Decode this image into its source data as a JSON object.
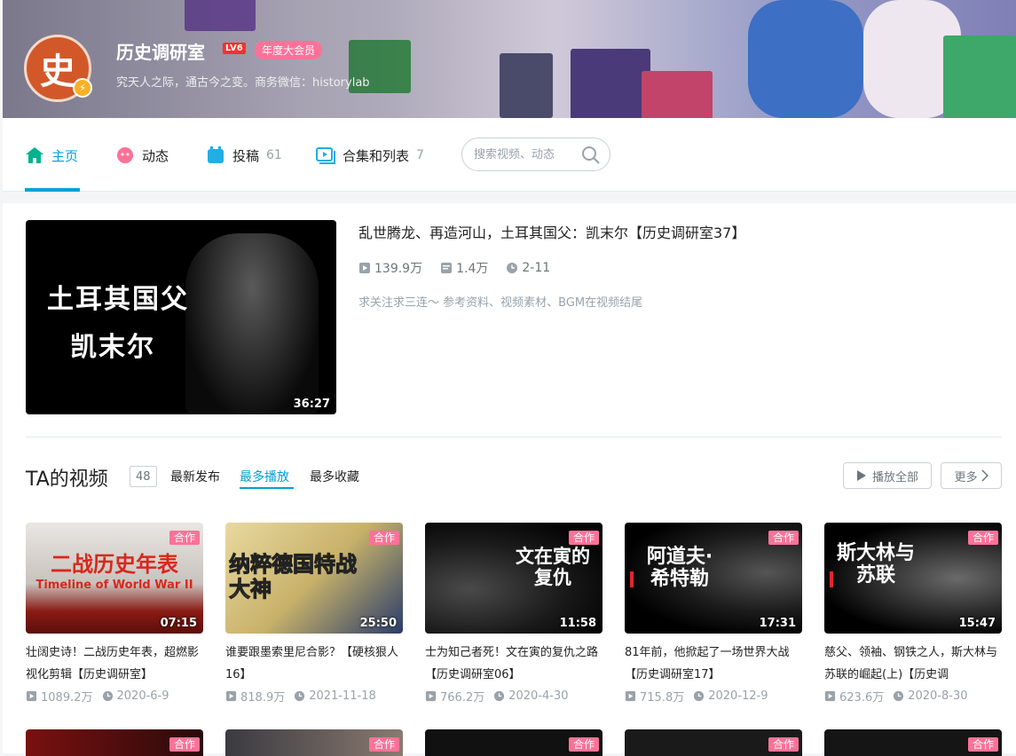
{
  "header": {
    "avatar_glyph": "史",
    "username": "历史调研室",
    "level": "LV6",
    "vip_label": "年度大会员",
    "sign": "究天人之际，通古今之变。商务微信：historylab"
  },
  "nav": {
    "items": [
      {
        "label": "主页",
        "count": "",
        "icon": "home-icon"
      },
      {
        "label": "动态",
        "count": "",
        "icon": "dynamic-icon"
      },
      {
        "label": "投稿",
        "count": "61",
        "icon": "upload-icon"
      },
      {
        "label": "合集和列表",
        "count": "7",
        "icon": "collection-icon"
      }
    ],
    "search_placeholder": "搜索视频、动态"
  },
  "featured": {
    "thumb_line1": "土耳其国父",
    "thumb_line2": "凯末尔",
    "duration": "36:27",
    "title": "乱世腾龙、再造河山，土耳其国父：凯末尔【历史调研室37】",
    "plays": "139.9万",
    "danmaku": "1.4万",
    "date": "2-11",
    "desc": "求关注求三连～ 参考资料、视频素材、BGM在视频结尾"
  },
  "videos_section": {
    "title": "TA的视频",
    "count": "48",
    "tabs": [
      "最新发布",
      "最多播放",
      "最多收藏"
    ],
    "play_all": "播放全部",
    "more": "更多"
  },
  "videos": [
    {
      "thumb_text": "二战历史年表",
      "thumb_sub": "Timeline of World War II",
      "tag": "合作",
      "duration": "07:15",
      "title": "壮阔史诗！二战历史年表，超燃影视化剪辑【历史调研室】",
      "plays": "1089.2万",
      "date": "2020-6-9"
    },
    {
      "thumb_text": "纳粹德国特战大神",
      "thumb_sub": "",
      "tag": "合作",
      "duration": "25:50",
      "title": "谁要跟墨索里尼合影？【硬核狠人16】",
      "plays": "818.9万",
      "date": "2021-11-18"
    },
    {
      "thumb_text": "文在寅的复仇",
      "thumb_sub": "",
      "tag": "合作",
      "duration": "11:58",
      "title": "士为知己者死！文在寅的复仇之路【历史调研室06】",
      "plays": "766.2万",
      "date": "2020-4-30"
    },
    {
      "thumb_text": "阿道夫·希特勒",
      "thumb_sub": "",
      "tag": "合作",
      "duration": "17:31",
      "title": "81年前，他掀起了一场世界大战【历史调研室17】",
      "plays": "715.8万",
      "date": "2020-12-9"
    },
    {
      "thumb_text": "斯大林与苏联",
      "thumb_sub": "",
      "tag": "合作",
      "duration": "15:47",
      "title": "慈父、领袖、钢铁之人，斯大林与苏联的崛起(上)【历史调",
      "plays": "623.6万",
      "date": "2020-8-30"
    }
  ],
  "next_row_tags": [
    "合作",
    "合作",
    "合作",
    "合作",
    "合作"
  ],
  "colors": {
    "accent": "#00a1d6",
    "pink": "#fb7299",
    "vip": "#fb7299",
    "level": "#ff2e2e"
  }
}
